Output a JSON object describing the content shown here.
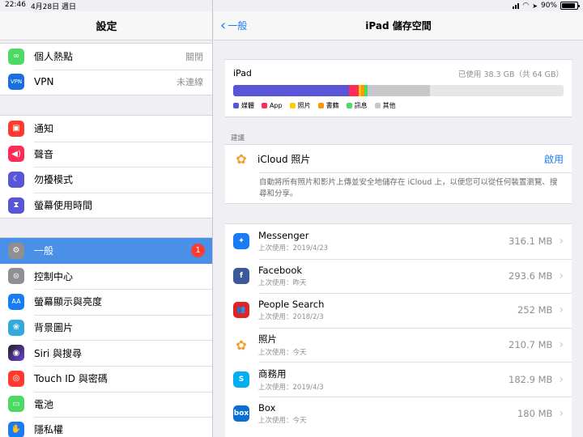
{
  "status": {
    "time": "22:46",
    "date": "4月28日 週日",
    "battery": "90%"
  },
  "left": {
    "title": "設定",
    "group1": [
      {
        "label": "個人熱點",
        "value": "關閉",
        "icon": "hotspot-icon",
        "color": "#4cd964"
      },
      {
        "label": "VPN",
        "value": "未連線",
        "icon": "vpn-icon",
        "color": "#1a6fe0",
        "glyph": "VPN"
      }
    ],
    "group2": [
      {
        "label": "通知",
        "icon": "notifications-icon",
        "color": "#ff3b30"
      },
      {
        "label": "聲音",
        "icon": "sounds-icon",
        "color": "#ff2d55"
      },
      {
        "label": "勿擾模式",
        "icon": "do-not-disturb-icon",
        "color": "#5856d6"
      },
      {
        "label": "螢幕使用時間",
        "icon": "screen-time-icon",
        "color": "#5856d6"
      }
    ],
    "group3": [
      {
        "label": "一般",
        "icon": "gear-icon",
        "color": "#8e8e93",
        "badge": "1",
        "selected": true
      },
      {
        "label": "控制中心",
        "icon": "control-center-icon",
        "color": "#8e8e93"
      },
      {
        "label": "螢幕顯示與亮度",
        "icon": "display-brightness-icon",
        "color": "#1a7cf2",
        "glyph": "AA"
      },
      {
        "label": "背景圖片",
        "icon": "wallpaper-icon",
        "color": "#34aadc"
      },
      {
        "label": "Siri 與搜尋",
        "icon": "siri-icon",
        "color": "#222"
      },
      {
        "label": "Touch ID 與密碼",
        "icon": "touch-id-icon",
        "color": "#ff3b30"
      },
      {
        "label": "電池",
        "icon": "battery-icon",
        "color": "#4cd964"
      },
      {
        "label": "隱私權",
        "icon": "privacy-hand-icon",
        "color": "#1a7cf2"
      }
    ]
  },
  "right": {
    "back": "一般",
    "title": "iPad 儲存空間",
    "storage": {
      "device": "iPad",
      "used": "已使用 38.3 GB（共 64 GB）",
      "segments": [
        {
          "name": "媒體",
          "color": "#5a55d6",
          "fraction": 0.35
        },
        {
          "name": "App",
          "color": "#ff2d55",
          "fraction": 0.03
        },
        {
          "name": "照片",
          "color": "#ffcc00",
          "fraction": 0.008
        },
        {
          "name": "書籍",
          "color": "#ff9500",
          "fraction": 0.008
        },
        {
          "name": "訊息",
          "color": "#4cd964",
          "fraction": 0.01
        },
        {
          "name": "其他",
          "color": "#c7c7cc",
          "fraction": 0.19
        }
      ]
    },
    "section_label": "建議",
    "recommendation": {
      "name": "iCloud 照片",
      "action": "啟用",
      "desc": "自動將所有照片和影片上傳並安全地儲存在 iCloud 上，以便您可以從任何裝置瀏覽、搜尋和分享。"
    },
    "apps": [
      {
        "name": "Messenger",
        "last": "上次使用：2019/4/23",
        "size": "316.1 MB",
        "icon": "messenger-icon",
        "color": "#1a7cf2",
        "glyph": "✦"
      },
      {
        "name": "Facebook",
        "last": "上次使用：昨天",
        "size": "293.6 MB",
        "icon": "facebook-icon",
        "color": "#3b5998",
        "glyph": "f"
      },
      {
        "name": "People Search",
        "last": "上次使用：2018/2/3",
        "size": "252 MB",
        "icon": "people-search-icon",
        "color": "#e02424",
        "glyph": "👥"
      },
      {
        "name": "照片",
        "last": "上次使用：今天",
        "size": "210.7 MB",
        "icon": "photos-icon",
        "color": "#ffffff",
        "glyph": "✿"
      },
      {
        "name": "商務用",
        "last": "上次使用：2019/4/3",
        "size": "182.9 MB",
        "icon": "skype-business-icon",
        "color": "#00aff0",
        "glyph": "S"
      },
      {
        "name": "Box",
        "last": "上次使用：今天",
        "size": "180 MB",
        "icon": "box-icon",
        "color": "#0a6fd1",
        "glyph": "box"
      }
    ]
  }
}
